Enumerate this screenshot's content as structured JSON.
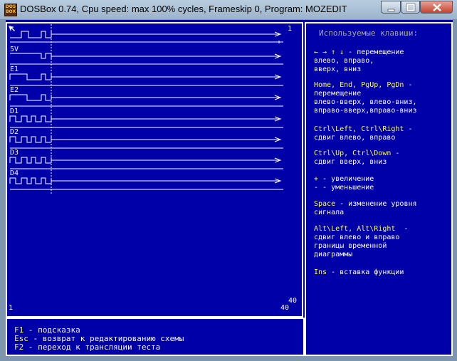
{
  "window": {
    "title": "DOSBox 0.74, Cpu speed: max 100% cycles, Frameskip  0, Program:  MOZEDIT",
    "icon": "dosbox-icon",
    "icon_text": "DOS BOX"
  },
  "diagram": {
    "top_marker": "1",
    "signals": [
      "",
      "5V",
      "E1",
      "E2",
      "D1",
      "D2",
      "D3",
      "D4"
    ],
    "axis_start": "1",
    "axis_end": "40",
    "right_end": "40"
  },
  "help": {
    "title": "Используемые клавиши:",
    "entries": [
      {
        "keys": "← → ↑ ↓",
        "desc": " - перемещение\nвлево, вправо,\nвверх, вниз"
      },
      {
        "keys": "Home, End, PgUp, PgDn",
        "desc": " -\nперемещение\nвлево-вверх, влево-вниз,\nвправо-вверх,вправо-вниз"
      },
      {
        "keys": "Ctrl\\Left, Ctrl\\Right",
        "desc": " -\nсдвиг влево, вправо"
      },
      {
        "keys": "Ctrl\\Up, Ctrl\\Down",
        "desc": " -\nсдвиг вверх, вниз"
      },
      {
        "keys": "+",
        "desc": " - увеличение\n- - уменьшение"
      },
      {
        "keys": "Space",
        "desc": " - изменение уровня\nсигнала"
      },
      {
        "keys": "Alt\\Left, Alt\\Right",
        "desc": "  -\nсдвиг влево и вправо\nграницы временной\nдиаграммы"
      },
      {
        "keys": "Ins",
        "desc": " - вставка функции"
      }
    ]
  },
  "footer": {
    "lines": [
      {
        "key": "F1",
        "text": " - подсказка"
      },
      {
        "key": "Esc",
        "text": " - возврат к редактированию схемы"
      },
      {
        "key": "F2",
        "text": " - переход к трансляции теста"
      }
    ]
  },
  "colors": {
    "background": "#0000a8",
    "text_white": "#fcfcfc",
    "text_yellow": "#fcfc54",
    "text_gray": "#a8a8a8"
  }
}
